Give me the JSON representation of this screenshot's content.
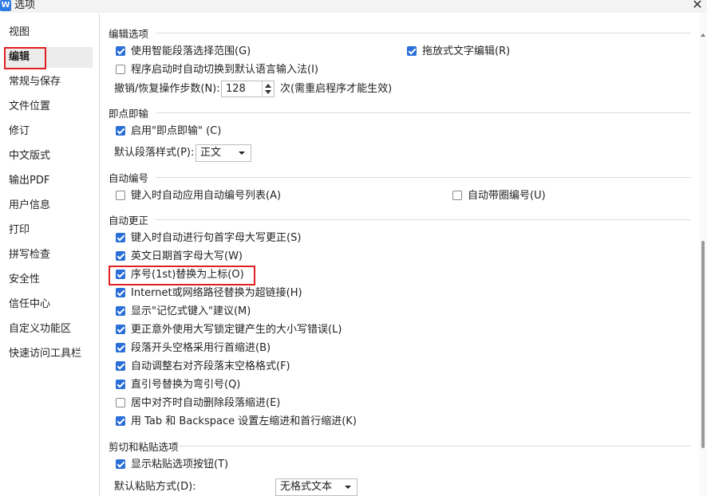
{
  "window": {
    "title": "选项",
    "app_icon": "W",
    "close_symbol": "✕"
  },
  "sidebar": {
    "items": [
      {
        "label": "视图"
      },
      {
        "label": "编辑",
        "active": true
      },
      {
        "label": "常规与保存"
      },
      {
        "label": "文件位置"
      },
      {
        "label": "修订"
      },
      {
        "label": "中文版式"
      },
      {
        "label": "输出PDF"
      },
      {
        "label": "用户信息"
      },
      {
        "label": "打印"
      },
      {
        "label": "拼写检查"
      },
      {
        "label": "安全性"
      },
      {
        "label": "信任中心"
      },
      {
        "label": "自定义功能区"
      },
      {
        "label": "快速访问工具栏"
      }
    ]
  },
  "sections": {
    "edit_options": {
      "title": "编辑选项",
      "smart_paragraph": {
        "label": "使用智能段落选择范围(G)",
        "checked": true
      },
      "drag_drop": {
        "label": "拖放式文字编辑(R)",
        "checked": true
      },
      "auto_ime": {
        "label": "程序启动时自动切换到默认语言输入法(I)",
        "checked": false
      },
      "undo_label": "撤销/恢复操作步数(N):",
      "undo_value": "128",
      "undo_note": "次(需重启程序才能生效)"
    },
    "click_type": {
      "title": "即点即输",
      "enable": {
        "label": "启用\"即点即输\" (C)",
        "checked": true
      },
      "style_label": "默认段落样式(P):",
      "style_value": "正文"
    },
    "auto_number": {
      "title": "自动编号",
      "auto_list": {
        "label": "键入时自动应用自动编号列表(A)",
        "checked": false
      },
      "circle_num": {
        "label": "自动带圈编号(U)",
        "checked": false
      }
    },
    "auto_correct": {
      "title": "自动更正",
      "options": [
        {
          "label": "键入时自动进行句首字母大写更正(S)",
          "checked": true
        },
        {
          "label": "英文日期首字母大写(W)",
          "checked": true
        },
        {
          "label": "序号(1st)替换为上标(O)",
          "checked": true
        },
        {
          "label": "Internet或网络路径替换为超链接(H)",
          "checked": true
        },
        {
          "label": "显示\"记忆式键入\"建议(M)",
          "checked": true
        },
        {
          "label": "更正意外使用大写锁定键产生的大小写错误(L)",
          "checked": true
        },
        {
          "label": "段落开头空格采用行首缩进(B)",
          "checked": true
        },
        {
          "label": "自动调整右对齐段落末空格格式(F)",
          "checked": true
        },
        {
          "label": "直引号替换为弯引号(Q)",
          "checked": true
        },
        {
          "label": "居中对齐时自动删除段落缩进(E)",
          "checked": false
        },
        {
          "label": "用 Tab 和 Backspace 设置左缩进和首行缩进(K)",
          "checked": true
        }
      ]
    },
    "cut_paste": {
      "title": "剪切和粘贴选项",
      "show_paste_btn": {
        "label": "显示粘贴选项按钮(T)",
        "checked": true
      },
      "paste_label": "默认粘贴方式(D):",
      "paste_value": "无格式文本"
    }
  },
  "colors": {
    "accent": "#2a6fd8",
    "highlight": "#e02020"
  }
}
